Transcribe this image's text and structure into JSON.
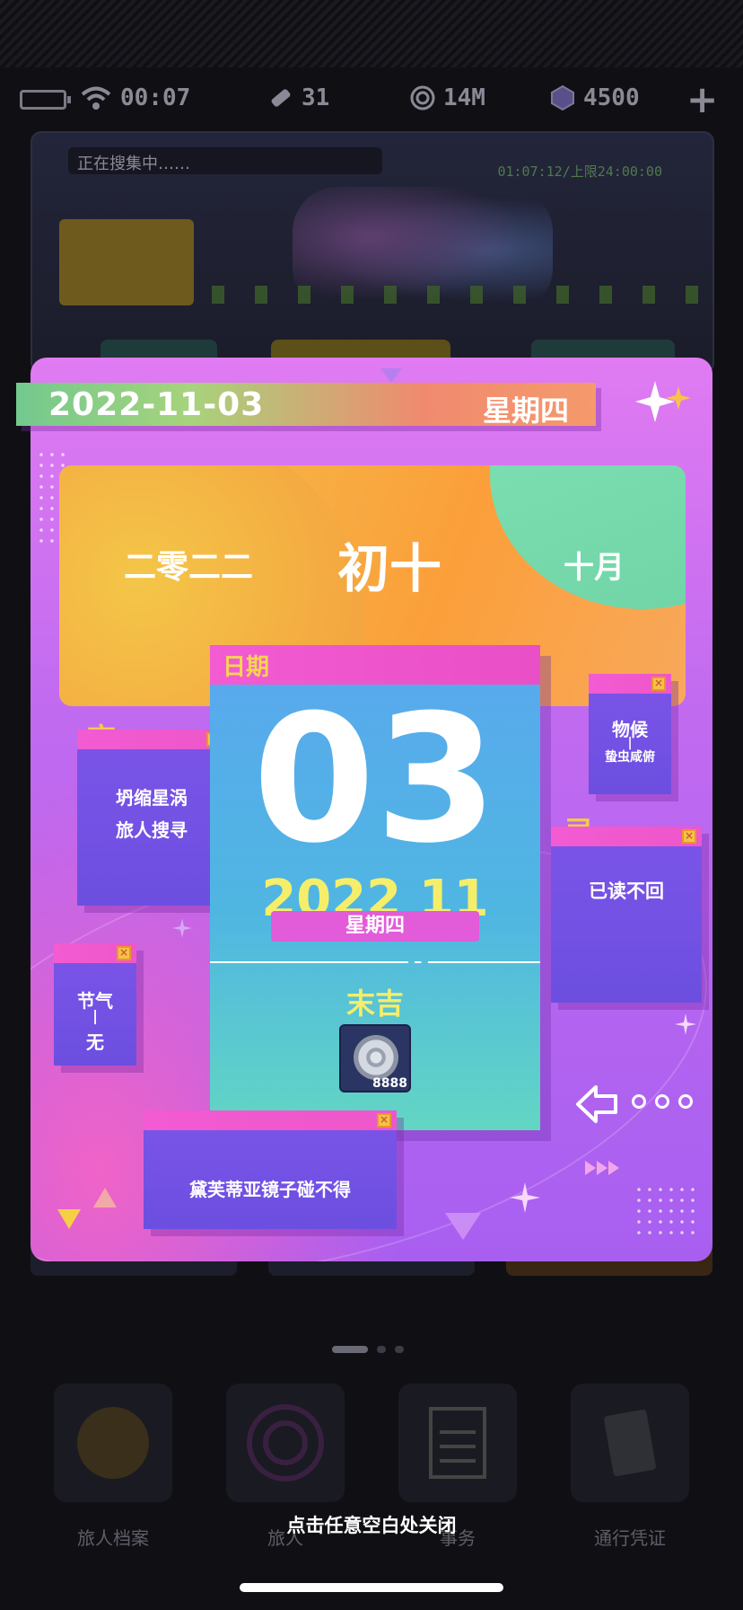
{
  "status_bar": {
    "time": "00:07",
    "stamina": "31",
    "coins": "14M",
    "gems": "4500"
  },
  "background": {
    "searching_text": "正在搜集中……",
    "timer_text": "01:07:12/上限24:00:00",
    "nav": [
      {
        "label": "旅人档案"
      },
      {
        "label": "旅人"
      },
      {
        "label": "事务"
      },
      {
        "label": "通行凭证"
      }
    ]
  },
  "calendar": {
    "date": "2022-11-03",
    "weekday": "星期四",
    "lunar_year": "二零二二",
    "lunar_day": "初十",
    "lunar_month": "十月",
    "card_header": "日期",
    "big_day": "03",
    "year_month": "2022 11",
    "weekday_badge": "星期四",
    "fortune": "末吉",
    "reward_amount": "8888",
    "yi_tag": "宜",
    "yi_items": [
      "坍缩星涡",
      "旅人搜寻"
    ],
    "wuhou_title": "物候",
    "wuhou_value": "蛰虫咸俯",
    "ji_tag": "忌",
    "ji_item": "已读不回",
    "jieqi_title": "节气",
    "jieqi_value": "无",
    "bottom_note": "黛芙蒂亚镜子碰不得"
  },
  "close_hint": "点击任意空白处关闭"
}
